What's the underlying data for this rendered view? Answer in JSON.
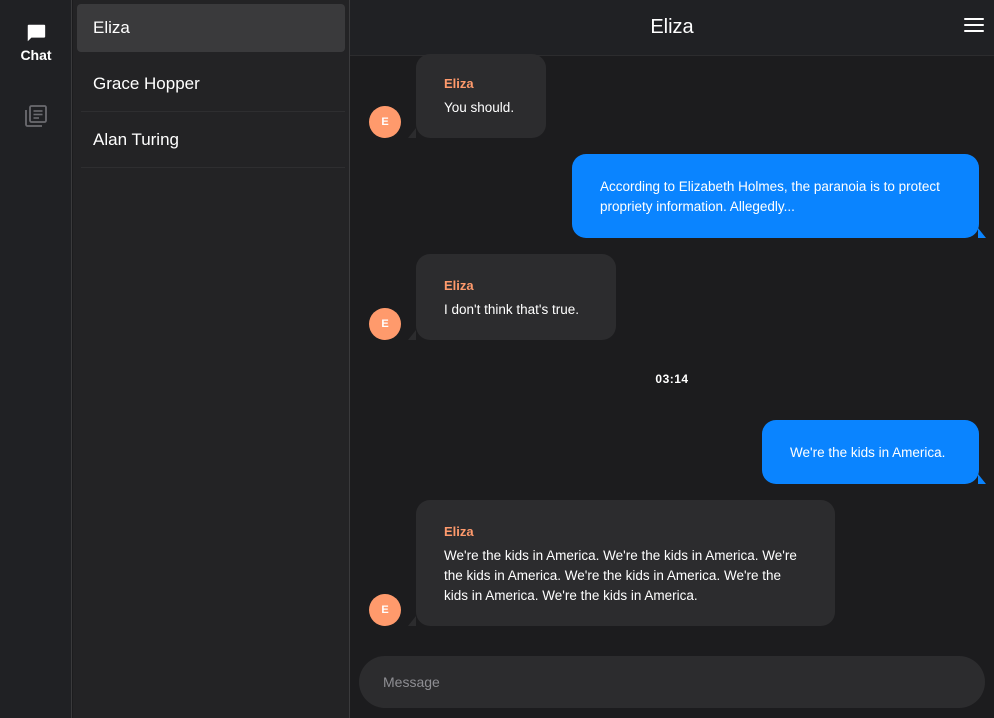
{
  "nav": {
    "chat_label": "Chat",
    "chat_icon": "chat-bubble-icon",
    "notes_icon": "library-icon"
  },
  "contacts": [
    {
      "name": "Eliza",
      "active": true
    },
    {
      "name": "Grace Hopper",
      "active": false
    },
    {
      "name": "Alan Turing",
      "active": false
    }
  ],
  "header": {
    "title": "Eliza",
    "menu_icon": "hamburger-menu-icon"
  },
  "messages": [
    {
      "direction": "incoming",
      "sender": "Eliza",
      "avatar_initial": "E",
      "text": "You should."
    },
    {
      "direction": "outgoing",
      "text": "According to Elizabeth Holmes, the paranoia is to protect propriety information. Allegedly..."
    },
    {
      "direction": "incoming",
      "sender": "Eliza",
      "avatar_initial": "E",
      "text": "I don't think that's true."
    },
    {
      "direction": "outgoing",
      "text": "We're the kids in America."
    },
    {
      "direction": "incoming",
      "sender": "Eliza",
      "avatar_initial": "E",
      "text": "We're the kids in America. We're the kids in America. We're the kids in America. We're the kids in America. We're the kids in America. We're the kids in America."
    }
  ],
  "timestamp": "03:14",
  "composer": {
    "placeholder": "Message"
  },
  "colors": {
    "accent_blue": "#0a84ff",
    "avatar_orange": "#ff9a6c",
    "background": "#1c1c1e"
  }
}
